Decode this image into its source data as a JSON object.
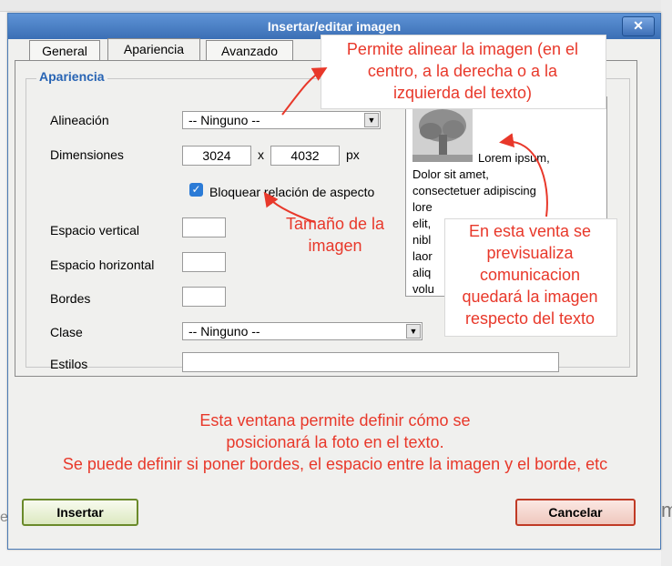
{
  "dialog": {
    "title": "Insertar/editar imagen",
    "close_label": "✕"
  },
  "tabs": [
    {
      "label": "General"
    },
    {
      "label": "Apariencia"
    },
    {
      "label": "Avanzado"
    }
  ],
  "appearance": {
    "legend": "Apariencia",
    "alignment_label": "Alineación",
    "alignment_value": "-- Ninguno --",
    "dimensions_label": "Dimensiones",
    "width_value": "3024",
    "times": "x",
    "height_value": "4032",
    "unit": "px",
    "lock_ratio_label": "Bloquear relación de aspecto",
    "lock_ratio_checked": true,
    "vspace_label": "Espacio vertical",
    "vspace_value": "",
    "hspace_label": "Espacio horizontal",
    "hspace_value": "",
    "border_label": "Bordes",
    "border_value": "",
    "class_label": "Clase",
    "class_value": "-- Ninguno --",
    "style_label": "Estilos",
    "style_value": ""
  },
  "preview": {
    "lines": [
      "Lorem ipsum,",
      "Dolor sit amet,",
      "consectetuer adipiscing",
      "lore",
      "elit,",
      "nibl",
      "laor",
      "aliq",
      "volu"
    ]
  },
  "annotations": {
    "align_note": [
      "Permite alinear la imagen (en el",
      "centro, a la derecha o a la",
      "izquierda del texto)"
    ],
    "size_note": [
      "Tamaño de la",
      "imagen"
    ],
    "preview_note": [
      "En esta venta se",
      "previsualiza",
      "comunicacion",
      "quedará la imagen",
      "respecto del texto"
    ],
    "window_note": [
      "Esta ventana permite definir cómo se",
      "posicionará la foto en el texto.",
      "Se puede definir si poner bordes, el espacio entre la imagen y el borde, etc"
    ],
    "color": "#e8382a"
  },
  "buttons": {
    "insert": "Insertar",
    "cancel": "Cancelar"
  },
  "background": {
    "left_char": "es",
    "right_char": "m"
  }
}
